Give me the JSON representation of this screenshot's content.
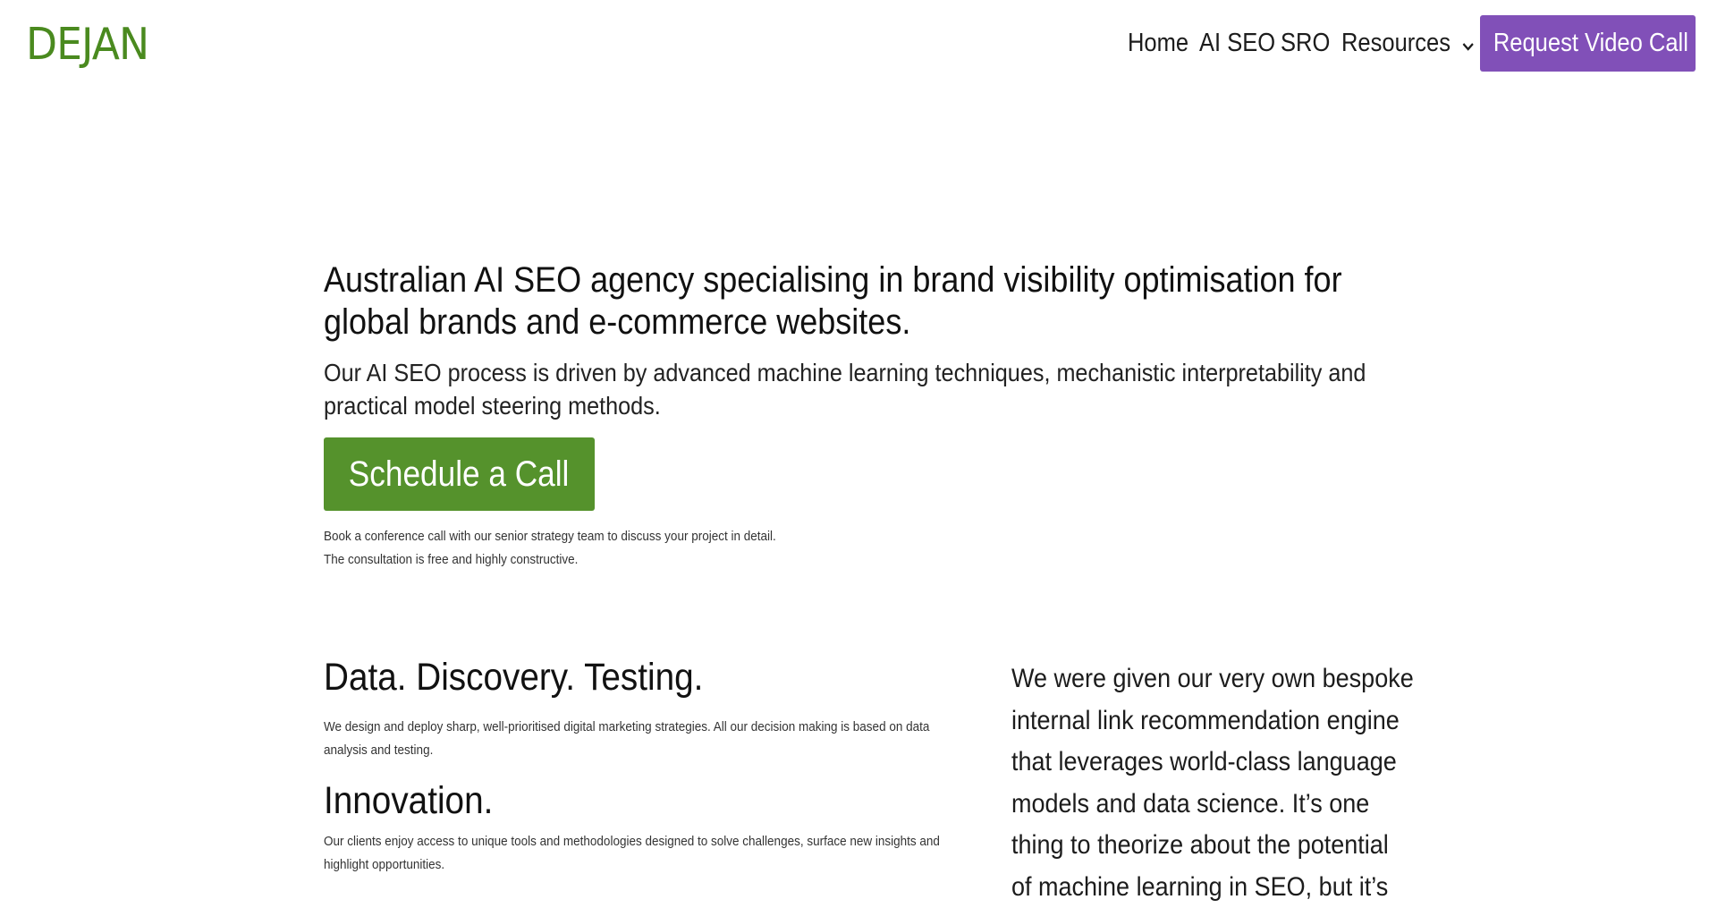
{
  "header": {
    "logo": "DEJAN",
    "nav": [
      {
        "label": "Home"
      },
      {
        "label": "AI SEO"
      },
      {
        "label": "SRO"
      },
      {
        "label": "Resources"
      }
    ],
    "cta_label": "Request Video Call",
    "colors": {
      "logo": "#4a8a1f",
      "cta": "#8150b8"
    }
  },
  "hero": {
    "title": "Australian AI SEO agency specialising in brand visibility optimisation for global brands and e-commerce websites.",
    "subtitle": "Our AI SEO process is driven by advanced machine learning techniques, mechanistic interpretability and practical model steering methods.",
    "button_label": "Schedule a Call",
    "note_line1": "Book a conference call with our senior strategy team to discuss your project in detail.",
    "note_line2": "The consultation is free and highly constructive.",
    "colors": {
      "button": "#55922c"
    }
  },
  "features": [
    {
      "title": "Data. Discovery. Testing.",
      "text": "We design and deploy sharp, well-prioritised digital marketing strategies. All our decision making is based on data analysis and testing."
    },
    {
      "title": "Innovation.",
      "text": "Our clients enjoy access to unique tools and methodologies designed to solve challenges, surface new insights and highlight opportunities."
    }
  ],
  "testimonial": {
    "text": "We were given our very own bespoke internal link recommendation engine that leverages world-class language models and data science. It’s one thing to theorize about the potential of machine learning in SEO, but it’s"
  }
}
